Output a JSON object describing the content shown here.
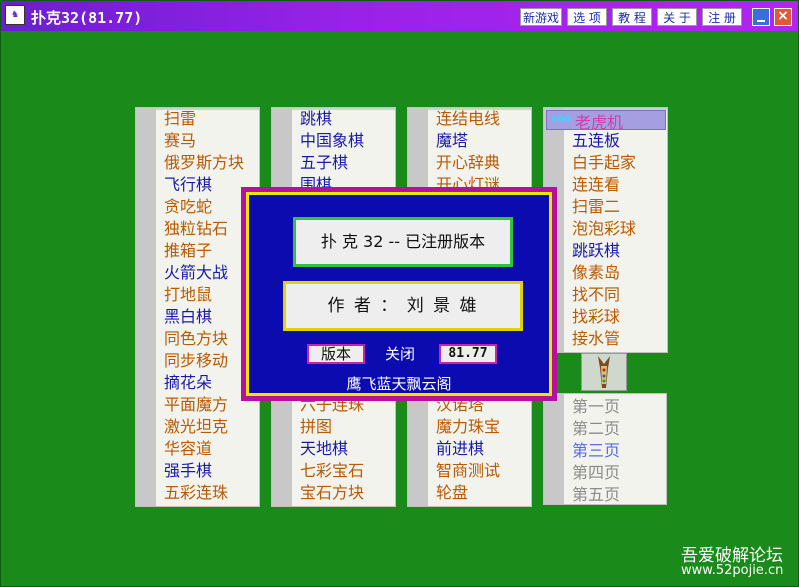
{
  "window": {
    "title": "扑克32(81.77)"
  },
  "toolbar": {
    "buttons": [
      "新游戏",
      "选 项",
      "教 程",
      "关 于",
      "注 册"
    ]
  },
  "panels": [
    {
      "items": [
        {
          "label": "扫雷",
          "color": "#b85a00"
        },
        {
          "label": "赛马",
          "color": "#b85a00"
        },
        {
          "label": "俄罗斯方块",
          "color": "#b85a00"
        },
        {
          "label": "飞行棋",
          "color": "#1a1aa8"
        },
        {
          "label": "贪吃蛇",
          "color": "#b85a00"
        },
        {
          "label": "独粒钻石",
          "color": "#b85a00"
        },
        {
          "label": "推箱子",
          "color": "#b85a00"
        },
        {
          "label": "火箭大战",
          "color": "#1a1aa8"
        },
        {
          "label": "打地鼠",
          "color": "#b85a00"
        },
        {
          "label": "黑白棋",
          "color": "#1a1aa8"
        },
        {
          "label": "同色方块",
          "color": "#b85a00"
        },
        {
          "label": "同步移动",
          "color": "#b85a00"
        },
        {
          "label": "摘花朵",
          "color": "#1a1aa8"
        },
        {
          "label": "平面魔方",
          "color": "#b85a00"
        },
        {
          "label": "激光坦克",
          "color": "#b85a00"
        },
        {
          "label": "华容道",
          "color": "#b85a00"
        },
        {
          "label": "强手棋",
          "color": "#1a1aa8"
        },
        {
          "label": "五彩连珠",
          "color": "#b85a00"
        }
      ]
    },
    {
      "items": [
        {
          "label": "跳棋",
          "color": "#1a1aa8"
        },
        {
          "label": "中国象棋",
          "color": "#1a1aa8"
        },
        {
          "label": "五子棋",
          "color": "#1a1aa8"
        },
        {
          "label": "围棋",
          "color": "#1a1aa8"
        },
        {
          "label": "",
          "color": "#b85a00"
        },
        {
          "label": "",
          "color": "#b85a00"
        },
        {
          "label": "",
          "color": "#b85a00"
        },
        {
          "label": "",
          "color": "#b85a00"
        },
        {
          "label": "",
          "color": "#b85a00"
        },
        {
          "label": "",
          "color": "#b85a00"
        },
        {
          "label": "",
          "color": "#b85a00"
        },
        {
          "label": "",
          "color": "#b85a00"
        },
        {
          "label": "",
          "color": "#b85a00"
        },
        {
          "label": "六子连珠",
          "color": "#b85a00"
        },
        {
          "label": "拼图",
          "color": "#b85a00"
        },
        {
          "label": "天地棋",
          "color": "#1a1aa8"
        },
        {
          "label": "七彩宝石",
          "color": "#b85a00"
        },
        {
          "label": "宝石方块",
          "color": "#b85a00"
        }
      ]
    },
    {
      "items": [
        {
          "label": "连结电线",
          "color": "#b85a00"
        },
        {
          "label": "魔塔",
          "color": "#1a1aa8"
        },
        {
          "label": "开心辞典",
          "color": "#b85a00"
        },
        {
          "label": "开心灯谜",
          "color": "#b85a00"
        },
        {
          "label": "",
          "color": "#b85a00"
        },
        {
          "label": "",
          "color": "#b85a00"
        },
        {
          "label": "",
          "color": "#b85a00"
        },
        {
          "label": "",
          "color": "#b85a00"
        },
        {
          "label": "",
          "color": "#b85a00"
        },
        {
          "label": "",
          "color": "#b85a00"
        },
        {
          "label": "",
          "color": "#b85a00"
        },
        {
          "label": "",
          "color": "#b85a00"
        },
        {
          "label": "",
          "color": "#b85a00"
        },
        {
          "label": "汉诺塔",
          "color": "#b85a00"
        },
        {
          "label": "魔力珠宝",
          "color": "#b85a00"
        },
        {
          "label": "前进棋",
          "color": "#1a1aa8"
        },
        {
          "label": "智商测试",
          "color": "#b85a00"
        },
        {
          "label": "轮盘",
          "color": "#b85a00"
        }
      ]
    },
    {
      "selected": {
        "badge": "100",
        "label": "老虎机"
      },
      "items": [
        {
          "label": "五连板",
          "color": "#1a1aa8"
        },
        {
          "label": "白手起家",
          "color": "#b85a00"
        },
        {
          "label": "连连看",
          "color": "#b85a00"
        },
        {
          "label": "扫雷二",
          "color": "#b85a00"
        },
        {
          "label": "泡泡彩球",
          "color": "#b85a00"
        },
        {
          "label": "跳跃棋",
          "color": "#1a1aa8"
        },
        {
          "label": "像素岛",
          "color": "#b85a00"
        },
        {
          "label": "找不同",
          "color": "#b85a00"
        },
        {
          "label": "找彩球",
          "color": "#b85a00"
        },
        {
          "label": "接水管",
          "color": "#b85a00"
        }
      ]
    }
  ],
  "pages": [
    {
      "label": "第一页",
      "active": false
    },
    {
      "label": "第二页",
      "active": false
    },
    {
      "label": "第三页",
      "active": true
    },
    {
      "label": "第四页",
      "active": false
    },
    {
      "label": "第五页",
      "active": false
    }
  ],
  "dialog": {
    "title": "扑 克 32 -- 已注册版本",
    "author": "作 者 ： 刘 景 雄",
    "version_button": "版本",
    "close_label": "关闭",
    "version_value": "81.77",
    "credit": "鹰飞蓝天飘云阁"
  },
  "watermark": {
    "line1": "吾爱破解论坛",
    "line2": "www.52pojie.cn"
  }
}
